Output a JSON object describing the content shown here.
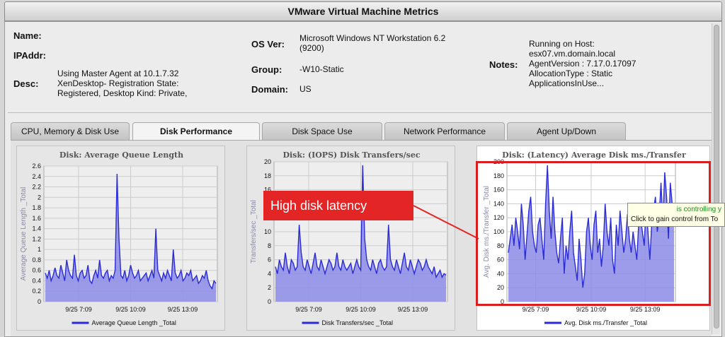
{
  "window": {
    "title": "VMware Virtual Machine Metrics"
  },
  "info": {
    "name_label": "Name:",
    "name_value": "",
    "ip_label": "IPAddr:",
    "ip_value": "",
    "desc_label": "Desc:",
    "desc_lines": [
      "Using Master Agent at 10.1.7.32",
      "XenDesktop- Registration State:",
      "Registered, Desktop Kind: Private,"
    ],
    "os_label": "OS Ver:",
    "os_lines": [
      "Microsoft Windows NT Workstation 6.2",
      "(9200)"
    ],
    "group_label": "Group:",
    "group_value": "-W10-Static",
    "domain_label": "Domain:",
    "domain_value": "US",
    "notes_label": "Notes:",
    "notes_lines": [
      "Running on Host:",
      "esx07.vm.domain.local",
      "AgentVersion : 7.17.0.17097",
      "AllocationType : Static",
      "ApplicationsInUse..."
    ]
  },
  "tabs": [
    {
      "label": "CPU, Memory & Disk Use",
      "active": false
    },
    {
      "label": "Disk Performance",
      "active": true
    },
    {
      "label": "Disk Space Use",
      "active": false
    },
    {
      "label": "Network Performance",
      "active": false
    },
    {
      "label": "Agent Up/Down",
      "active": false
    }
  ],
  "callout": {
    "text": "High disk latency",
    "color": "#e32526"
  },
  "tooltip": {
    "line1": "is controlling y",
    "line2": "Click to gain control from To"
  },
  "colors": {
    "series_line": "#2b2bd6",
    "series_fill": "#8b8be6"
  },
  "chart_data": [
    {
      "type": "area",
      "title": "Disk: Average Queue Length",
      "ylabel": "Average Queue Length _Total",
      "legend": "Average Queue Length _Total",
      "legend_position": "bottom",
      "grid": true,
      "ylim": [
        0,
        2.6
      ],
      "yticks": [
        0,
        0.2,
        0.4,
        0.6,
        0.8,
        1,
        1.2,
        1.4,
        1.6,
        1.8,
        2,
        2.2,
        2.4,
        2.6
      ],
      "ytick_labels": [
        "0",
        "0.2",
        "0.4",
        "0.6",
        "0.8",
        "1",
        "1.2",
        "1.4",
        "1.6",
        "1.8",
        "2",
        "2.2",
        "2.4",
        "2.6"
      ],
      "xtick_labels": [
        "9/25 7:09",
        "9/25 10:09",
        "9/25 13:09"
      ],
      "xtick_positions": [
        0.2,
        0.5,
        0.8
      ],
      "series": [
        {
          "name": "Average Queue Length _Total",
          "values": [
            0.55,
            0.45,
            0.6,
            0.4,
            0.5,
            0.65,
            0.5,
            0.45,
            0.7,
            0.55,
            0.4,
            0.8,
            0.6,
            0.5,
            0.45,
            0.9,
            0.5,
            0.4,
            0.55,
            0.6,
            0.45,
            0.5,
            0.7,
            0.4,
            0.35,
            0.5,
            0.6,
            0.45,
            0.8,
            0.5,
            0.45,
            0.55,
            0.6,
            0.4,
            0.5,
            0.45,
            0.6,
            2.45,
            1.2,
            0.5,
            0.45,
            0.6,
            0.4,
            0.5,
            0.7,
            0.55,
            0.45,
            0.5,
            0.6,
            0.4,
            0.45,
            0.5,
            0.55,
            0.4,
            0.5,
            0.6,
            0.45,
            1.4,
            0.6,
            0.5,
            0.4,
            0.55,
            0.45,
            0.6,
            0.5,
            0.4,
            1.0,
            0.55,
            0.45,
            0.5,
            0.6,
            0.4,
            0.45,
            0.55,
            0.5,
            0.6,
            0.4,
            0.45,
            0.5,
            0.35,
            0.4,
            0.5,
            0.45,
            0.6,
            0.4,
            0.3,
            0.25,
            0.4,
            0.35
          ]
        }
      ]
    },
    {
      "type": "area",
      "title": "Disk: (IOPS) Disk Transfers/sec",
      "ylabel": "Transfers/sec _Total",
      "legend": "Disk Transfers/sec _Total",
      "legend_position": "bottom",
      "grid": true,
      "ylim": [
        0,
        20
      ],
      "yticks": [
        0,
        2,
        4,
        6,
        8,
        10,
        12,
        14,
        16,
        18,
        20
      ],
      "ytick_labels": [
        "0",
        "2",
        "4",
        "6",
        "8",
        "10",
        "12",
        "14",
        "16",
        "18",
        "20"
      ],
      "xtick_labels": [
        "9/25 7:09",
        "9/25 10:09",
        "9/25 13:09"
      ],
      "xtick_positions": [
        0.2,
        0.5,
        0.8
      ],
      "series": [
        {
          "name": "Disk Transfers/sec _Total",
          "values": [
            5,
            4,
            6,
            5,
            4.5,
            7,
            5,
            4,
            6,
            5.5,
            4.5,
            5,
            11,
            7,
            5,
            4.5,
            6,
            5,
            4,
            5.5,
            7,
            5,
            4.5,
            6,
            5,
            4,
            5,
            6,
            5.5,
            4.5,
            5,
            7,
            5,
            4.5,
            6,
            5,
            4.5,
            5,
            5.5,
            4,
            5,
            6,
            5,
            4.5,
            19.5,
            9,
            6,
            5,
            4.5,
            6,
            5,
            4,
            5.5,
            6,
            5,
            4.5,
            5,
            11,
            6,
            5,
            4.5,
            6,
            5,
            4,
            5.5,
            7,
            5,
            4.5,
            6,
            5,
            4,
            5,
            6,
            5.5,
            4.5,
            5,
            6,
            5,
            4.5,
            4,
            5,
            3.5,
            4,
            4.5,
            3.5,
            4,
            3.8
          ]
        }
      ]
    },
    {
      "type": "area",
      "title": "Disk: (Latency) Average Disk ms./Transfer",
      "ylabel": "Avg. Disk ms./Transfer _Total",
      "legend": "Avg. Disk ms./Transfer _Total",
      "legend_position": "bottom",
      "grid": true,
      "ylim": [
        0,
        200
      ],
      "yticks": [
        0,
        20,
        40,
        60,
        80,
        100,
        120,
        140,
        160,
        180,
        200
      ],
      "ytick_labels": [
        "0",
        "20",
        "40",
        "60",
        "80",
        "100",
        "120",
        "140",
        "160",
        "180",
        "200"
      ],
      "xtick_labels": [
        "9/25 7:09",
        "9/25 10:09",
        "9/25 13:09"
      ],
      "xtick_positions": [
        0.17,
        0.5,
        0.82
      ],
      "series": [
        {
          "name": "Avg. Disk ms./Transfer _Total",
          "values": [
            70,
            90,
            110,
            80,
            120,
            100,
            75,
            140,
            110,
            60,
            95,
            130,
            150,
            100,
            80,
            70,
            110,
            120,
            90,
            60,
            140,
            195,
            130,
            90,
            150,
            100,
            70,
            55,
            90,
            120,
            40,
            80,
            60,
            100,
            130,
            70,
            50,
            30,
            90,
            60,
            20,
            40,
            100,
            120,
            80,
            60,
            110,
            130,
            70,
            90,
            50,
            80,
            140,
            100,
            80,
            120,
            60,
            40,
            110,
            80,
            130,
            100,
            70,
            90,
            125,
            90,
            70,
            100,
            80,
            60,
            110,
            120,
            100,
            80,
            140,
            100,
            60,
            110,
            130,
            150,
            100,
            120,
            170,
            110,
            185,
            150,
            90,
            170,
            140,
            110
          ]
        }
      ]
    }
  ]
}
